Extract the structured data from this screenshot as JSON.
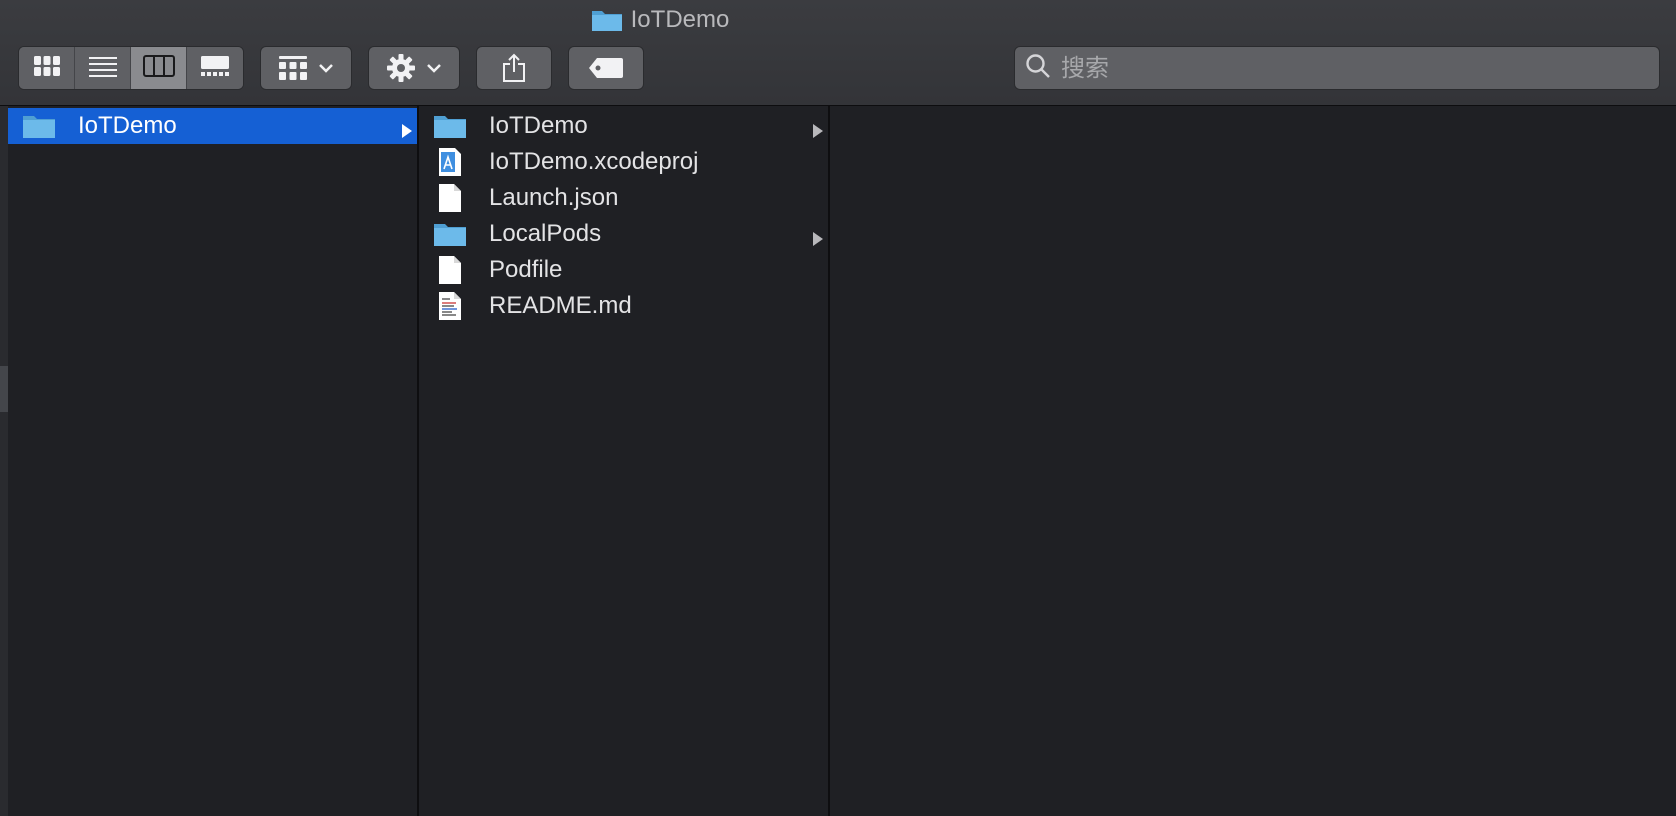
{
  "window": {
    "title": "IoTDemo"
  },
  "toolbar": {
    "view_modes": [
      {
        "name": "icon-view",
        "icon": "grid-icon",
        "active": false
      },
      {
        "name": "list-view",
        "icon": "list-icon",
        "active": false
      },
      {
        "name": "column-view",
        "icon": "columns-icon",
        "active": true
      },
      {
        "name": "gallery-view",
        "icon": "gallery-icon",
        "active": false
      }
    ],
    "group_icon": "group-by-icon",
    "action_icon": "gear-icon",
    "share_icon": "share-icon",
    "tag_icon": "tag-icon"
  },
  "search": {
    "placeholder": "搜索"
  },
  "columns": {
    "col1": [
      {
        "label": "IoTDemo",
        "type": "folder",
        "selected": true,
        "has_children": true
      }
    ],
    "col2": [
      {
        "label": "IoTDemo",
        "type": "folder",
        "has_children": true
      },
      {
        "label": "IoTDemo.xcodeproj",
        "type": "xcodeproj",
        "has_children": false
      },
      {
        "label": "Launch.json",
        "type": "file",
        "has_children": false
      },
      {
        "label": "LocalPods",
        "type": "folder",
        "has_children": true
      },
      {
        "label": "Podfile",
        "type": "file",
        "has_children": false
      },
      {
        "label": "README.md",
        "type": "text-file",
        "has_children": false
      }
    ]
  },
  "colors": {
    "selection": "#1560d4",
    "folder": "#62b3e6",
    "background": "#1f2024"
  }
}
